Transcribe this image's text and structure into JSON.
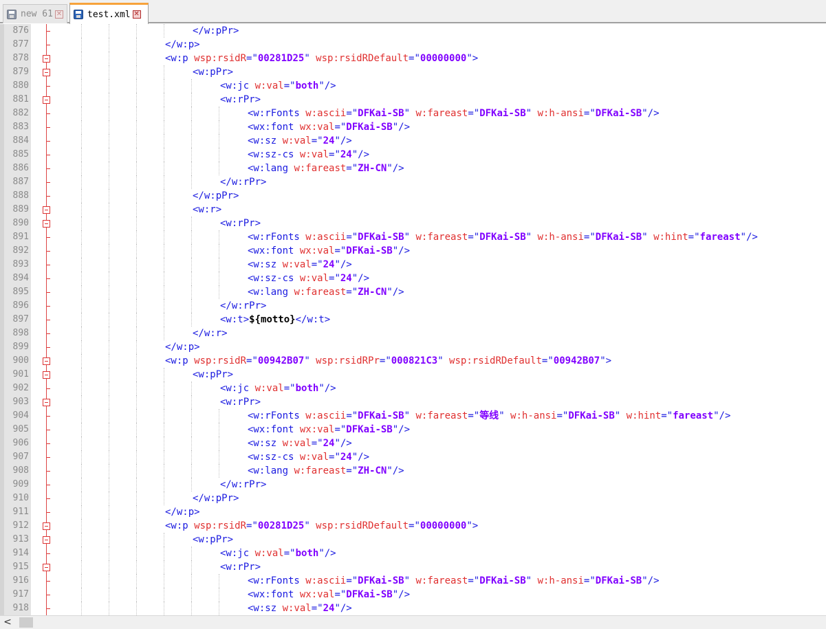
{
  "tabs": [
    {
      "label": "new 61",
      "active": false,
      "icon": "save-disk-icon",
      "close": "✕"
    },
    {
      "label": "test.xml",
      "active": true,
      "icon": "save-disk-icon",
      "close": "✕"
    }
  ],
  "colors": {
    "tag": "#1a1ae0",
    "attribute": "#e03030",
    "value": "#8000ff",
    "text": "#000000",
    "fold_margin": "#d33333",
    "active_tab_accent": "#f7a33b"
  },
  "scrollbar": {
    "left_arrow": "<"
  },
  "lines": [
    {
      "num": "876",
      "fold": "tick",
      "indent": 4,
      "tokens": [
        [
          "tg",
          "</w:pPr>"
        ]
      ]
    },
    {
      "num": "877",
      "fold": "tick",
      "indent": 3,
      "tokens": [
        [
          "tg",
          "</w:p>"
        ]
      ]
    },
    {
      "num": "878",
      "fold": "box",
      "indent": 3,
      "tokens": [
        [
          "tg",
          "<w:p "
        ],
        [
          "at",
          "wsp:rsidR"
        ],
        [
          "tg",
          "=\""
        ],
        [
          "vl",
          "00281D25"
        ],
        [
          "tg",
          "\" "
        ],
        [
          "at",
          "wsp:rsidRDefault"
        ],
        [
          "tg",
          "=\""
        ],
        [
          "vl",
          "00000000"
        ],
        [
          "tg",
          "\">"
        ]
      ]
    },
    {
      "num": "879",
      "fold": "box",
      "indent": 4,
      "tokens": [
        [
          "tg",
          "<w:pPr>"
        ]
      ]
    },
    {
      "num": "880",
      "fold": "tick",
      "indent": 5,
      "tokens": [
        [
          "tg",
          "<w:jc "
        ],
        [
          "at",
          "w:val"
        ],
        [
          "tg",
          "=\""
        ],
        [
          "vl",
          "both"
        ],
        [
          "tg",
          "\"/>"
        ]
      ]
    },
    {
      "num": "881",
      "fold": "box",
      "indent": 5,
      "tokens": [
        [
          "tg",
          "<w:rPr>"
        ]
      ]
    },
    {
      "num": "882",
      "fold": "tick",
      "indent": 6,
      "tokens": [
        [
          "tg",
          "<w:rFonts "
        ],
        [
          "at",
          "w:ascii"
        ],
        [
          "tg",
          "=\""
        ],
        [
          "vl",
          "DFKai-SB"
        ],
        [
          "tg",
          "\" "
        ],
        [
          "at",
          "w:fareast"
        ],
        [
          "tg",
          "=\""
        ],
        [
          "vl",
          "DFKai-SB"
        ],
        [
          "tg",
          "\" "
        ],
        [
          "at",
          "w:h-ansi"
        ],
        [
          "tg",
          "=\""
        ],
        [
          "vl",
          "DFKai-SB"
        ],
        [
          "tg",
          "\"/>"
        ]
      ]
    },
    {
      "num": "883",
      "fold": "tick",
      "indent": 6,
      "tokens": [
        [
          "tg",
          "<wx:font "
        ],
        [
          "at",
          "wx:val"
        ],
        [
          "tg",
          "=\""
        ],
        [
          "vl",
          "DFKai-SB"
        ],
        [
          "tg",
          "\"/>"
        ]
      ]
    },
    {
      "num": "884",
      "fold": "tick",
      "indent": 6,
      "tokens": [
        [
          "tg",
          "<w:sz "
        ],
        [
          "at",
          "w:val"
        ],
        [
          "tg",
          "=\""
        ],
        [
          "vl",
          "24"
        ],
        [
          "tg",
          "\"/>"
        ]
      ]
    },
    {
      "num": "885",
      "fold": "tick",
      "indent": 6,
      "tokens": [
        [
          "tg",
          "<w:sz-cs "
        ],
        [
          "at",
          "w:val"
        ],
        [
          "tg",
          "=\""
        ],
        [
          "vl",
          "24"
        ],
        [
          "tg",
          "\"/>"
        ]
      ]
    },
    {
      "num": "886",
      "fold": "tick",
      "indent": 6,
      "tokens": [
        [
          "tg",
          "<w:lang "
        ],
        [
          "at",
          "w:fareast"
        ],
        [
          "tg",
          "=\""
        ],
        [
          "vl",
          "ZH-CN"
        ],
        [
          "tg",
          "\"/>"
        ]
      ]
    },
    {
      "num": "887",
      "fold": "tick",
      "indent": 5,
      "tokens": [
        [
          "tg",
          "</w:rPr>"
        ]
      ]
    },
    {
      "num": "888",
      "fold": "tick",
      "indent": 4,
      "tokens": [
        [
          "tg",
          "</w:pPr>"
        ]
      ]
    },
    {
      "num": "889",
      "fold": "box",
      "indent": 4,
      "tokens": [
        [
          "tg",
          "<w:r>"
        ]
      ]
    },
    {
      "num": "890",
      "fold": "box",
      "indent": 5,
      "tokens": [
        [
          "tg",
          "<w:rPr>"
        ]
      ]
    },
    {
      "num": "891",
      "fold": "tick",
      "indent": 6,
      "tokens": [
        [
          "tg",
          "<w:rFonts "
        ],
        [
          "at",
          "w:ascii"
        ],
        [
          "tg",
          "=\""
        ],
        [
          "vl",
          "DFKai-SB"
        ],
        [
          "tg",
          "\" "
        ],
        [
          "at",
          "w:fareast"
        ],
        [
          "tg",
          "=\""
        ],
        [
          "vl",
          "DFKai-SB"
        ],
        [
          "tg",
          "\" "
        ],
        [
          "at",
          "w:h-ansi"
        ],
        [
          "tg",
          "=\""
        ],
        [
          "vl",
          "DFKai-SB"
        ],
        [
          "tg",
          "\" "
        ],
        [
          "at",
          "w:hint"
        ],
        [
          "tg",
          "=\""
        ],
        [
          "vl",
          "fareast"
        ],
        [
          "tg",
          "\"/>"
        ]
      ]
    },
    {
      "num": "892",
      "fold": "tick",
      "indent": 6,
      "tokens": [
        [
          "tg",
          "<wx:font "
        ],
        [
          "at",
          "wx:val"
        ],
        [
          "tg",
          "=\""
        ],
        [
          "vl",
          "DFKai-SB"
        ],
        [
          "tg",
          "\"/>"
        ]
      ]
    },
    {
      "num": "893",
      "fold": "tick",
      "indent": 6,
      "tokens": [
        [
          "tg",
          "<w:sz "
        ],
        [
          "at",
          "w:val"
        ],
        [
          "tg",
          "=\""
        ],
        [
          "vl",
          "24"
        ],
        [
          "tg",
          "\"/>"
        ]
      ]
    },
    {
      "num": "894",
      "fold": "tick",
      "indent": 6,
      "tokens": [
        [
          "tg",
          "<w:sz-cs "
        ],
        [
          "at",
          "w:val"
        ],
        [
          "tg",
          "=\""
        ],
        [
          "vl",
          "24"
        ],
        [
          "tg",
          "\"/>"
        ]
      ]
    },
    {
      "num": "895",
      "fold": "tick",
      "indent": 6,
      "tokens": [
        [
          "tg",
          "<w:lang "
        ],
        [
          "at",
          "w:fareast"
        ],
        [
          "tg",
          "=\""
        ],
        [
          "vl",
          "ZH-CN"
        ],
        [
          "tg",
          "\"/>"
        ]
      ]
    },
    {
      "num": "896",
      "fold": "tick",
      "indent": 5,
      "tokens": [
        [
          "tg",
          "</w:rPr>"
        ]
      ]
    },
    {
      "num": "897",
      "fold": "tick",
      "indent": 5,
      "tokens": [
        [
          "tg",
          "<w:t>"
        ],
        [
          "tx",
          "${motto}"
        ],
        [
          "tg",
          "</w:t>"
        ]
      ]
    },
    {
      "num": "898",
      "fold": "tick",
      "indent": 4,
      "tokens": [
        [
          "tg",
          "</w:r>"
        ]
      ]
    },
    {
      "num": "899",
      "fold": "tick",
      "indent": 3,
      "tokens": [
        [
          "tg",
          "</w:p>"
        ]
      ]
    },
    {
      "num": "900",
      "fold": "box",
      "indent": 3,
      "tokens": [
        [
          "tg",
          "<w:p "
        ],
        [
          "at",
          "wsp:rsidR"
        ],
        [
          "tg",
          "=\""
        ],
        [
          "vl",
          "00942B07"
        ],
        [
          "tg",
          "\" "
        ],
        [
          "at",
          "wsp:rsidRPr"
        ],
        [
          "tg",
          "=\""
        ],
        [
          "vl",
          "000821C3"
        ],
        [
          "tg",
          "\" "
        ],
        [
          "at",
          "wsp:rsidRDefault"
        ],
        [
          "tg",
          "=\""
        ],
        [
          "vl",
          "00942B07"
        ],
        [
          "tg",
          "\">"
        ]
      ]
    },
    {
      "num": "901",
      "fold": "box",
      "indent": 4,
      "tokens": [
        [
          "tg",
          "<w:pPr>"
        ]
      ]
    },
    {
      "num": "902",
      "fold": "tick",
      "indent": 5,
      "tokens": [
        [
          "tg",
          "<w:jc "
        ],
        [
          "at",
          "w:val"
        ],
        [
          "tg",
          "=\""
        ],
        [
          "vl",
          "both"
        ],
        [
          "tg",
          "\"/>"
        ]
      ]
    },
    {
      "num": "903",
      "fold": "box",
      "indent": 5,
      "tokens": [
        [
          "tg",
          "<w:rPr>"
        ]
      ]
    },
    {
      "num": "904",
      "fold": "tick",
      "indent": 6,
      "tokens": [
        [
          "tg",
          "<w:rFonts "
        ],
        [
          "at",
          "w:ascii"
        ],
        [
          "tg",
          "=\""
        ],
        [
          "vl",
          "DFKai-SB"
        ],
        [
          "tg",
          "\" "
        ],
        [
          "at",
          "w:fareast"
        ],
        [
          "tg",
          "=\""
        ],
        [
          "vl",
          "等线"
        ],
        [
          "tg",
          "\" "
        ],
        [
          "at",
          "w:h-ansi"
        ],
        [
          "tg",
          "=\""
        ],
        [
          "vl",
          "DFKai-SB"
        ],
        [
          "tg",
          "\" "
        ],
        [
          "at",
          "w:hint"
        ],
        [
          "tg",
          "=\""
        ],
        [
          "vl",
          "fareast"
        ],
        [
          "tg",
          "\"/>"
        ]
      ]
    },
    {
      "num": "905",
      "fold": "tick",
      "indent": 6,
      "tokens": [
        [
          "tg",
          "<wx:font "
        ],
        [
          "at",
          "wx:val"
        ],
        [
          "tg",
          "=\""
        ],
        [
          "vl",
          "DFKai-SB"
        ],
        [
          "tg",
          "\"/>"
        ]
      ]
    },
    {
      "num": "906",
      "fold": "tick",
      "indent": 6,
      "tokens": [
        [
          "tg",
          "<w:sz "
        ],
        [
          "at",
          "w:val"
        ],
        [
          "tg",
          "=\""
        ],
        [
          "vl",
          "24"
        ],
        [
          "tg",
          "\"/>"
        ]
      ]
    },
    {
      "num": "907",
      "fold": "tick",
      "indent": 6,
      "tokens": [
        [
          "tg",
          "<w:sz-cs "
        ],
        [
          "at",
          "w:val"
        ],
        [
          "tg",
          "=\""
        ],
        [
          "vl",
          "24"
        ],
        [
          "tg",
          "\"/>"
        ]
      ]
    },
    {
      "num": "908",
      "fold": "tick",
      "indent": 6,
      "tokens": [
        [
          "tg",
          "<w:lang "
        ],
        [
          "at",
          "w:fareast"
        ],
        [
          "tg",
          "=\""
        ],
        [
          "vl",
          "ZH-CN"
        ],
        [
          "tg",
          "\"/>"
        ]
      ]
    },
    {
      "num": "909",
      "fold": "tick",
      "indent": 5,
      "tokens": [
        [
          "tg",
          "</w:rPr>"
        ]
      ]
    },
    {
      "num": "910",
      "fold": "tick",
      "indent": 4,
      "tokens": [
        [
          "tg",
          "</w:pPr>"
        ]
      ]
    },
    {
      "num": "911",
      "fold": "tick",
      "indent": 3,
      "tokens": [
        [
          "tg",
          "</w:p>"
        ]
      ]
    },
    {
      "num": "912",
      "fold": "box",
      "indent": 3,
      "tokens": [
        [
          "tg",
          "<w:p "
        ],
        [
          "at",
          "wsp:rsidR"
        ],
        [
          "tg",
          "=\""
        ],
        [
          "vl",
          "00281D25"
        ],
        [
          "tg",
          "\" "
        ],
        [
          "at",
          "wsp:rsidRDefault"
        ],
        [
          "tg",
          "=\""
        ],
        [
          "vl",
          "00000000"
        ],
        [
          "tg",
          "\">"
        ]
      ]
    },
    {
      "num": "913",
      "fold": "box",
      "indent": 4,
      "tokens": [
        [
          "tg",
          "<w:pPr>"
        ]
      ]
    },
    {
      "num": "914",
      "fold": "tick",
      "indent": 5,
      "tokens": [
        [
          "tg",
          "<w:jc "
        ],
        [
          "at",
          "w:val"
        ],
        [
          "tg",
          "=\""
        ],
        [
          "vl",
          "both"
        ],
        [
          "tg",
          "\"/>"
        ]
      ]
    },
    {
      "num": "915",
      "fold": "box",
      "indent": 5,
      "tokens": [
        [
          "tg",
          "<w:rPr>"
        ]
      ]
    },
    {
      "num": "916",
      "fold": "tick",
      "indent": 6,
      "tokens": [
        [
          "tg",
          "<w:rFonts "
        ],
        [
          "at",
          "w:ascii"
        ],
        [
          "tg",
          "=\""
        ],
        [
          "vl",
          "DFKai-SB"
        ],
        [
          "tg",
          "\" "
        ],
        [
          "at",
          "w:fareast"
        ],
        [
          "tg",
          "=\""
        ],
        [
          "vl",
          "DFKai-SB"
        ],
        [
          "tg",
          "\" "
        ],
        [
          "at",
          "w:h-ansi"
        ],
        [
          "tg",
          "=\""
        ],
        [
          "vl",
          "DFKai-SB"
        ],
        [
          "tg",
          "\"/>"
        ]
      ]
    },
    {
      "num": "917",
      "fold": "tick",
      "indent": 6,
      "tokens": [
        [
          "tg",
          "<wx:font "
        ],
        [
          "at",
          "wx:val"
        ],
        [
          "tg",
          "=\""
        ],
        [
          "vl",
          "DFKai-SB"
        ],
        [
          "tg",
          "\"/>"
        ]
      ]
    },
    {
      "num": "918",
      "fold": "tick",
      "indent": 6,
      "tokens": [
        [
          "tg",
          "<w:sz "
        ],
        [
          "at",
          "w:val"
        ],
        [
          "tg",
          "=\""
        ],
        [
          "vl",
          "24"
        ],
        [
          "tg",
          "\"/>"
        ]
      ]
    }
  ]
}
